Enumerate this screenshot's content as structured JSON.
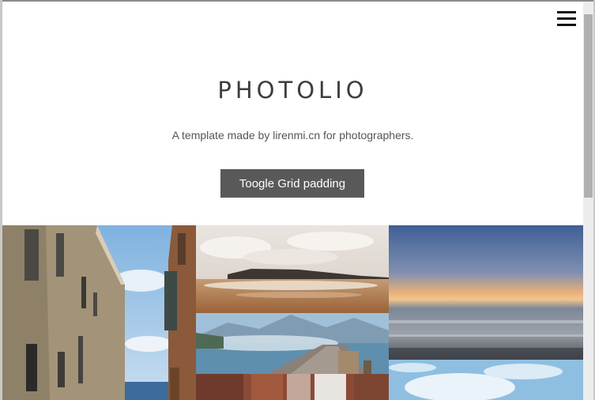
{
  "header": {
    "title": "PHOTOLIO",
    "subtitle": "A template made by lirenmi.cn for photographers.",
    "toggle_button": "Toogle Grid padding"
  },
  "nav": {
    "menu_icon": "hamburger-menu-icon"
  },
  "gallery": {
    "photos": [
      {
        "name": "street-buildings-photo",
        "subject": "old buildings under blue sky"
      },
      {
        "name": "beach-clouds-photo",
        "subject": "sandy shore with cloudy sky"
      },
      {
        "name": "sunset-sea-photo",
        "subject": "long exposure sea at sunset"
      },
      {
        "name": "lake-pier-photo",
        "subject": "wooden pier on mountain lake"
      },
      {
        "name": "rooftops-photo",
        "subject": "rooftops"
      },
      {
        "name": "sky-clouds-photo",
        "subject": "bright cloudy sky"
      }
    ]
  }
}
